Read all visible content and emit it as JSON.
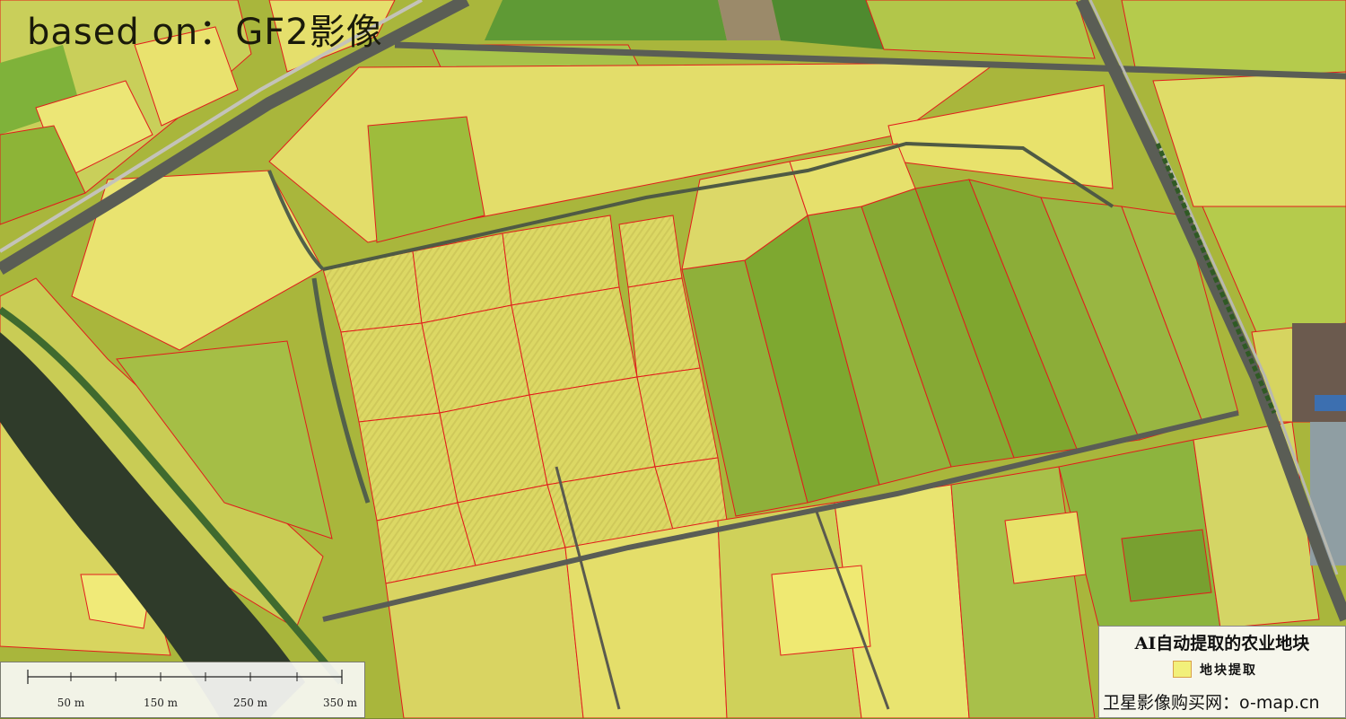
{
  "title": "based on：GF2影像",
  "scale_bar": {
    "labels": [
      "50 m",
      "150 m",
      "250 m",
      "350 m"
    ]
  },
  "legend": {
    "title": "AI自动提取的农业地块",
    "item_label": "地块提取",
    "item_swatch_fill": "#f2f07a",
    "item_swatch_stroke": "#d9a04a",
    "source": "卫星影像购买网：o-map.cn"
  },
  "colors": {
    "boundary": "#e21b1b",
    "field_yellow": "#e6e268",
    "field_green": "#86a834",
    "road": "#5a5d55",
    "river": "#2e3a28"
  }
}
